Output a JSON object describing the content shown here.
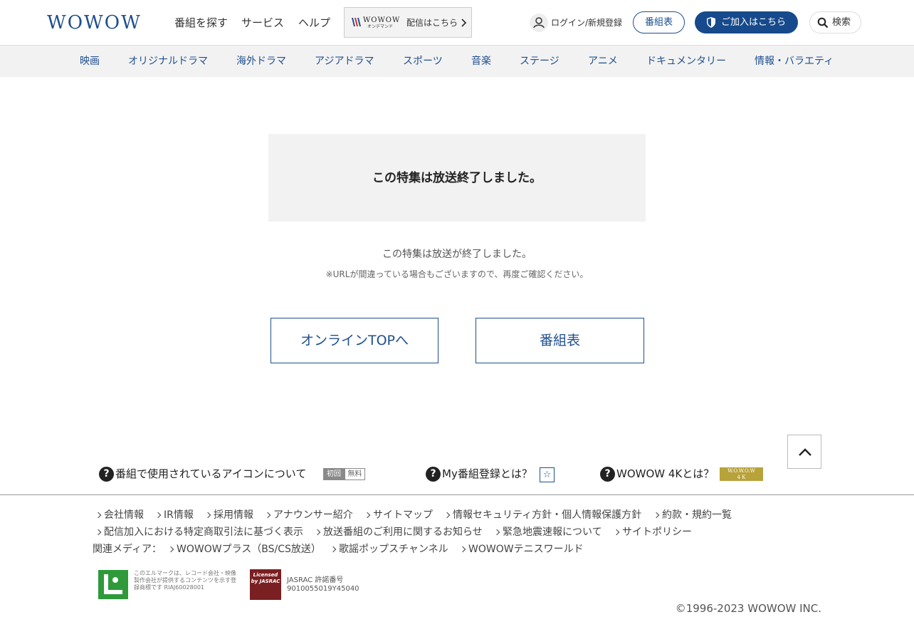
{
  "header": {
    "logo": "WOWOW",
    "nav": [
      "番組を探す",
      "サービス",
      "ヘルプ"
    ],
    "on_demand": {
      "logo": "WOWOW",
      "logo_sub": "オンデマンド",
      "label": "配信はこちら"
    },
    "login_label": "ログイン/新規登録",
    "schedule_label": "番組表",
    "join_label": "ご加入はこちら",
    "search_label": "検索"
  },
  "genres": [
    "映画",
    "オリジナルドラマ",
    "海外ドラマ",
    "アジアドラマ",
    "スポーツ",
    "音楽",
    "ステージ",
    "アニメ",
    "ドキュメンタリー",
    "情報・バラエティ"
  ],
  "main": {
    "notice_title": "この特集は放送終了しました。",
    "message": "この特集は放送が終了しました。",
    "message_sub": "※URLが間違っている場合もございますので、再度ご確認ください。",
    "btn_online_top": "オンラインTOPへ",
    "btn_schedule": "番組表"
  },
  "help": {
    "icons_label": "番組で使用されているアイコンについて",
    "badge_first": "初回",
    "badge_free": "無料",
    "mylist_label": "My番組登録とは？",
    "star": "☆",
    "fourk_label": "WOWOW 4Kとは？",
    "fourk_badge_top": "W.O.W.O.W",
    "fourk_badge_bottom": "4 K"
  },
  "footer": {
    "links_row1": [
      "会社情報",
      "IR情報",
      "採用情報",
      "アナウンサー紹介",
      "サイトマップ",
      "情報セキュリティ方針・個人情報保護方針",
      "約款・規約一覧"
    ],
    "links_row2": [
      "配信加入における特定商取引法に基づく表示",
      "放送番組のご利用に関するお知らせ",
      "緊急地震速報について",
      "サイトポリシー"
    ],
    "media_label": "関連メディア：",
    "media_links": [
      "WOWOWプラス（BS/CS放送）",
      "歌謡ポップスチャンネル",
      "WOWOWテニスワールド"
    ],
    "lmark_text": "このエルマークは、レコード会社・映像製作会社が提供するコンテンツを示す登録商標です RIAJ60028001",
    "jasrac_logo": "Licensed by JASRAC",
    "jasrac_line1": "JASRAC 許諾番号",
    "jasrac_line2": "9010055019Y45040",
    "copyright": "©1996-2023 WOWOW INC."
  },
  "colors": {
    "brand": "#1f4f8f",
    "join_button": "#174a8c",
    "genre_bar": "#f2f2f2"
  }
}
